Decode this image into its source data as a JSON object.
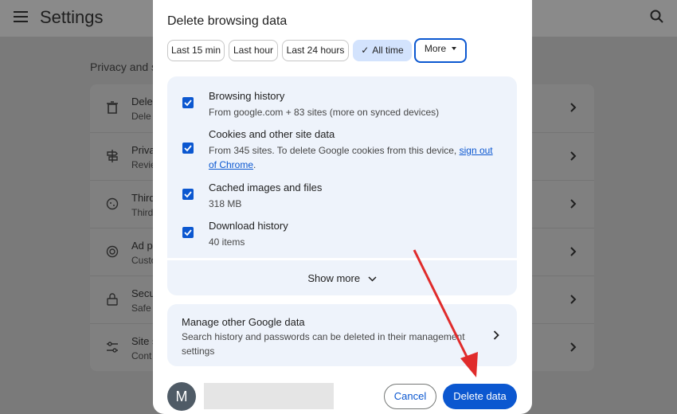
{
  "background": {
    "title": "Settings",
    "section_title": "Privacy and s",
    "rows": [
      {
        "icon": "trash-icon",
        "glyph": "🗑",
        "title": "Dele",
        "sub": "Dele"
      },
      {
        "icon": "privacy-guide-icon",
        "glyph": "⇄",
        "title": "Priva",
        "sub": "Revie"
      },
      {
        "icon": "cookie-icon",
        "glyph": "◌",
        "title": "Third",
        "sub": "Third"
      },
      {
        "icon": "ad-privacy-icon",
        "glyph": "◎",
        "title": "Ad p",
        "sub": "Custo"
      },
      {
        "icon": "lock-icon",
        "glyph": "🔒",
        "title": "Secu",
        "sub": "Safe"
      },
      {
        "icon": "site-settings-icon",
        "glyph": "≡",
        "title": "Site s",
        "sub": "Cont"
      }
    ]
  },
  "dialog": {
    "title": "Delete browsing data",
    "time_ranges": [
      {
        "label": "Last 15 min",
        "selected": false
      },
      {
        "label": "Last hour",
        "selected": false
      },
      {
        "label": "Last 24 hours",
        "selected": false
      },
      {
        "label": "All time",
        "selected": true
      },
      {
        "label": "More",
        "selected": false,
        "dropdown": true
      }
    ],
    "items": [
      {
        "title": "Browsing history",
        "desc": "From google.com + 83 sites (more on synced devices)",
        "checked": true
      },
      {
        "title": "Cookies and other site data",
        "desc_prefix": "From 345 sites. To delete Google cookies from this device, ",
        "desc_link_1": "sign out",
        "desc_link_2": "of Chrome",
        "desc_suffix": ".",
        "checked": true
      },
      {
        "title": "Cached images and files",
        "desc": "318 MB",
        "checked": true
      },
      {
        "title": "Download history",
        "desc": "40 items",
        "checked": true
      }
    ],
    "show_more": "Show more",
    "manage": {
      "title": "Manage other Google data",
      "desc": "Search history and passwords can be deleted in their management settings"
    },
    "footer": {
      "avatar_letter": "M",
      "cancel_label": "Cancel",
      "delete_label": "Delete data"
    }
  },
  "colors": {
    "accent": "#0b57d0",
    "chip_selected": "#d3e3fd",
    "card_bg": "#eef3fb",
    "annotation_arrow": "#e02b2b"
  }
}
